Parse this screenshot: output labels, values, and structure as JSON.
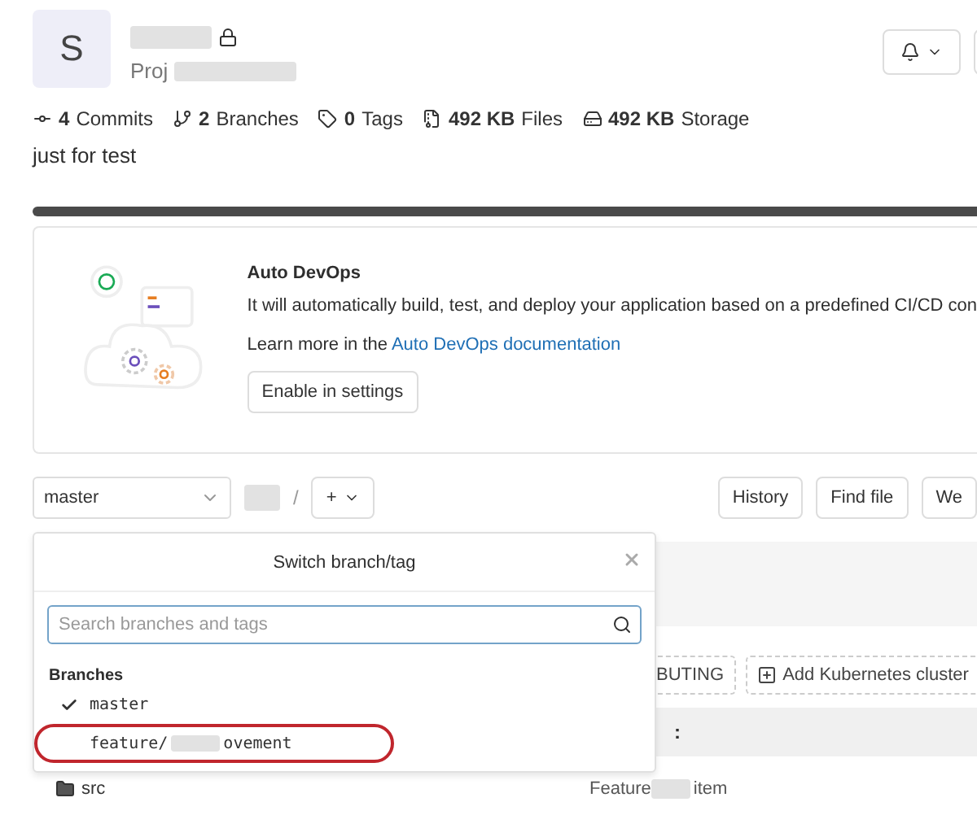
{
  "project": {
    "avatar_letter": "S",
    "subtitle": "Proj"
  },
  "stats": [
    {
      "kind": "commits",
      "count": "4",
      "label": "Commits"
    },
    {
      "kind": "branches",
      "count": "2",
      "label": "Branches"
    },
    {
      "kind": "tags",
      "count": "0",
      "label": "Tags"
    },
    {
      "kind": "files",
      "count": "492 KB",
      "label": "Files"
    },
    {
      "kind": "storage",
      "count": "492 KB",
      "label": "Storage"
    }
  ],
  "description": "just for test",
  "auto_devops": {
    "title": "Auto DevOps",
    "text": "It will automatically build, test, and deploy your application based on a predefined CI/CD con",
    "learn_prefix": "Learn more in the",
    "link": "Auto DevOps documentation",
    "button": "Enable in settings"
  },
  "toolbar": {
    "branch": "master",
    "separator": "/",
    "add": "+",
    "buttons": [
      "History",
      "Find file",
      "We"
    ]
  },
  "shortcuts": [
    {
      "kind": "text",
      "label": "BUTING"
    },
    {
      "kind": "add",
      "label": "Add Kubernetes cluster"
    }
  ],
  "table_header": ":",
  "files": [
    {
      "name": "src",
      "commit": [
        "Feature",
        "item"
      ]
    }
  ],
  "dropdown": {
    "title": "Switch branch/tag",
    "search": {
      "placeholder": "Search branches and tags"
    },
    "section": "Branches",
    "items": [
      {
        "parts": [
          "master"
        ],
        "selected": true,
        "circled": false
      },
      {
        "parts": [
          "feature/",
          "ovement"
        ],
        "selected": false,
        "circled": true
      }
    ]
  }
}
